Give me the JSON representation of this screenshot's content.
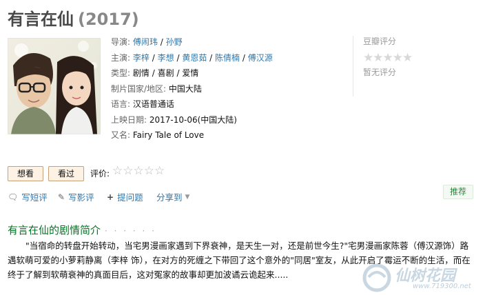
{
  "movie": {
    "title": "有言在仙",
    "year": "(2017)"
  },
  "info": {
    "director_label": "导演:",
    "directors": [
      "傅闹玮",
      "孙野"
    ],
    "cast_label": "主演:",
    "cast": [
      "李梓",
      "李想",
      "黄恩茹",
      "陈倩楠",
      "傅汉源"
    ],
    "genre_label": "类型:",
    "genres": [
      "剧情",
      "喜剧",
      "爱情"
    ],
    "region_label": "制片国家/地区:",
    "region": "中国大陆",
    "language_label": "语言:",
    "language": "汉语普通话",
    "release_label": "上映日期:",
    "release": "2017-10-06(中国大陆)",
    "aka_label": "又名:",
    "aka": "Fairy Tale of Love",
    "separator": "/"
  },
  "rating": {
    "label": "豆瓣评分",
    "stars_filled": 0,
    "stars_total": 5,
    "none_text": "暂无评分"
  },
  "actions": {
    "want_label": "想看",
    "seen_label": "看过",
    "rate_label": "评价:",
    "short_review": "写短评",
    "review": "写影评",
    "ask": "提问题",
    "share": "分享到",
    "recommend": "推荐"
  },
  "summary": {
    "title": "有言在仙的剧情简介",
    "dots": "· · · · · ·",
    "text": "\"当宿命的转盘开始转动，当宅男漫画家遇到下界衰神，是天生一对，还是前世今生?\"宅男漫画家陈蓉（傅汉源饰）路遇软萌可爱的小萝莉静离（李梓 饰），在对方的死缠之下带回了这个意外的\"同居\"室友，从此开启了霉运不断的生活，而在终于了解到软萌衰神的真面目后，这对冤家的故事却更加波谲云诡起来....."
  },
  "watermark": {
    "text": "仙树花园",
    "url": "www.719300.net"
  },
  "colors": {
    "link": "#3377aa",
    "green": "#007722"
  }
}
